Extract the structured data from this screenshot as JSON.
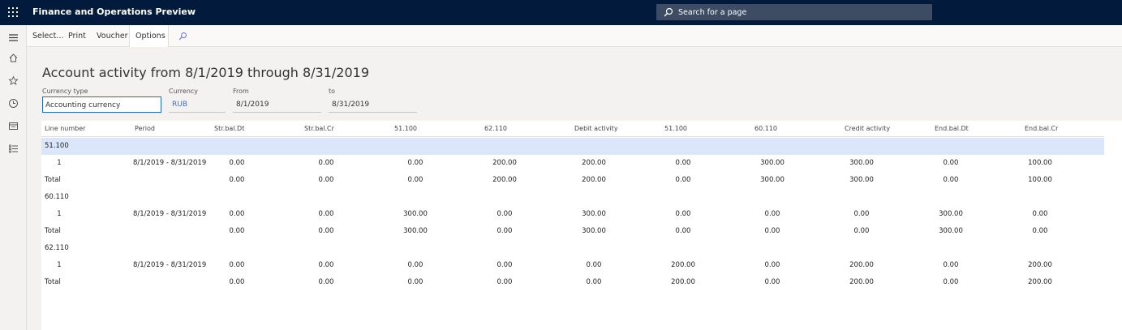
{
  "app": {
    "title": "Finance and Operations Preview",
    "search_placeholder": "Search for a page"
  },
  "actions": [
    "Select...",
    "Print",
    "Voucher",
    "Options"
  ],
  "page": {
    "title": "Account activity from 8/1/2019 through 8/31/2019"
  },
  "filters": {
    "currency_type": {
      "label": "Currency type",
      "value": "Accounting currency"
    },
    "currency": {
      "label": "Currency",
      "value": "RUB"
    },
    "from": {
      "label": "From",
      "value": "8/1/2019"
    },
    "to": {
      "label": "to",
      "value": "8/31/2019"
    }
  },
  "table": {
    "columns": [
      "Line number",
      "Period",
      "Str.bal.Dt",
      "Str.bal.Cr",
      "51.100",
      "62.110",
      "Debit activity",
      "51.100",
      "60.110",
      "Credit activity",
      "End.bal.Dt",
      "End.bal.Cr"
    ],
    "groups": [
      {
        "account": "51.100",
        "line": {
          "number": "1",
          "period": "8/1/2019 - 8/31/2019",
          "values": [
            "0.00",
            "0.00",
            "0.00",
            "200.00",
            "200.00",
            "0.00",
            "300.00",
            "300.00",
            "0.00",
            "100.00"
          ]
        },
        "total": {
          "label": "Total",
          "values": [
            "0.00",
            "0.00",
            "0.00",
            "200.00",
            "200.00",
            "0.00",
            "300.00",
            "300.00",
            "0.00",
            "100.00"
          ]
        }
      },
      {
        "account": "60.110",
        "line": {
          "number": "1",
          "period": "8/1/2019 - 8/31/2019",
          "values": [
            "0.00",
            "0.00",
            "300.00",
            "0.00",
            "300.00",
            "0.00",
            "0.00",
            "0.00",
            "300.00",
            "0.00"
          ]
        },
        "total": {
          "label": "Total",
          "values": [
            "0.00",
            "0.00",
            "300.00",
            "0.00",
            "300.00",
            "0.00",
            "0.00",
            "0.00",
            "300.00",
            "0.00"
          ]
        }
      },
      {
        "account": "62.110",
        "line": {
          "number": "1",
          "period": "8/1/2019 - 8/31/2019",
          "values": [
            "0.00",
            "0.00",
            "0.00",
            "0.00",
            "0.00",
            "200.00",
            "0.00",
            "200.00",
            "0.00",
            "200.00"
          ]
        },
        "total": {
          "label": "Total",
          "values": [
            "0.00",
            "0.00",
            "0.00",
            "0.00",
            "0.00",
            "200.00",
            "0.00",
            "200.00",
            "0.00",
            "200.00"
          ]
        }
      }
    ]
  },
  "colors": {
    "topbar": "#021a3c",
    "selection": "#dbe6fb",
    "focus": "#2266e3"
  }
}
